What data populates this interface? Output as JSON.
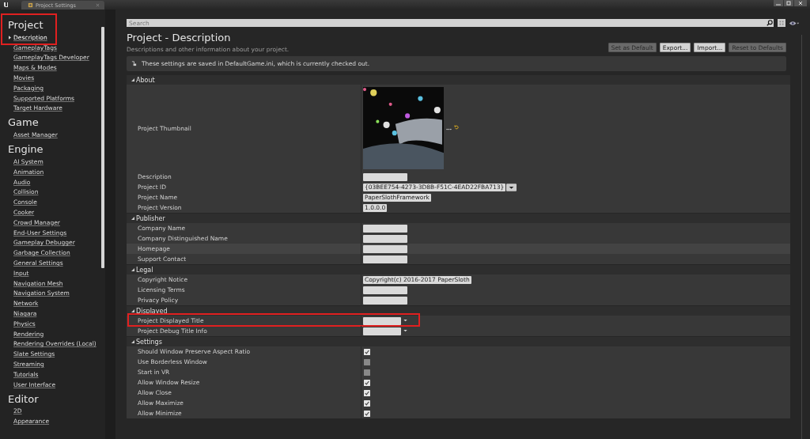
{
  "tab": {
    "title": "Project Settings"
  },
  "sidebar": {
    "sections": [
      {
        "heading": "Project",
        "highlighted": true,
        "items": [
          {
            "label": "Description",
            "selected": true
          },
          {
            "label": "GameplayTags",
            "selected": false
          },
          {
            "label": "GameplayTags Developer",
            "selected": false
          },
          {
            "label": "Maps & Modes",
            "selected": false
          },
          {
            "label": "Movies",
            "selected": false
          },
          {
            "label": "Packaging",
            "selected": false
          },
          {
            "label": "Supported Platforms",
            "selected": false
          },
          {
            "label": "Target Hardware",
            "selected": false
          }
        ]
      },
      {
        "heading": "Game",
        "items": [
          {
            "label": "Asset Manager",
            "selected": false
          }
        ]
      },
      {
        "heading": "Engine",
        "items": [
          {
            "label": "AI System",
            "selected": false
          },
          {
            "label": "Animation",
            "selected": false
          },
          {
            "label": "Audio",
            "selected": false
          },
          {
            "label": "Collision",
            "selected": false
          },
          {
            "label": "Console",
            "selected": false
          },
          {
            "label": "Cooker",
            "selected": false
          },
          {
            "label": "Crowd Manager",
            "selected": false
          },
          {
            "label": "End-User Settings",
            "selected": false
          },
          {
            "label": "Gameplay Debugger",
            "selected": false
          },
          {
            "label": "Garbage Collection",
            "selected": false
          },
          {
            "label": "General Settings",
            "selected": false
          },
          {
            "label": "Input",
            "selected": false
          },
          {
            "label": "Navigation Mesh",
            "selected": false
          },
          {
            "label": "Navigation System",
            "selected": false
          },
          {
            "label": "Network",
            "selected": false
          },
          {
            "label": "Niagara",
            "selected": false
          },
          {
            "label": "Physics",
            "selected": false
          },
          {
            "label": "Rendering",
            "selected": false
          },
          {
            "label": "Rendering Overrides (Local)",
            "selected": false
          },
          {
            "label": "Slate Settings",
            "selected": false
          },
          {
            "label": "Streaming",
            "selected": false
          },
          {
            "label": "Tutorials",
            "selected": false
          },
          {
            "label": "User Interface",
            "selected": false
          }
        ]
      },
      {
        "heading": "Editor",
        "items": [
          {
            "label": "2D",
            "selected": false
          },
          {
            "label": "Appearance",
            "selected": false
          }
        ]
      }
    ]
  },
  "search": {
    "placeholder": "Search"
  },
  "header": {
    "title": "Project - Description",
    "subtitle": "Descriptions and other information about your project."
  },
  "buttons": [
    {
      "label": "Set as Default",
      "disabled": true
    },
    {
      "label": "Export...",
      "disabled": false
    },
    {
      "label": "Import...",
      "disabled": false
    },
    {
      "label": "Reset to Defaults",
      "disabled": true
    }
  ],
  "notice": "These settings are saved in DefaultGame.ini, which is currently checked out.",
  "categories": [
    {
      "name": "About",
      "expanded": true,
      "rows": [
        {
          "label": "Project Thumbnail",
          "kind": "thumbnail"
        },
        {
          "label": "Description",
          "kind": "text"
        },
        {
          "label": "Project ID",
          "kind": "combo",
          "value": "{03BEE754-4273-3D8B-F51C-4EAD22FBA713}"
        },
        {
          "label": "Project Name",
          "kind": "text",
          "value": "PaperSlothFramework"
        },
        {
          "label": "Project Version",
          "kind": "text",
          "value": "1.0.0.0"
        }
      ]
    },
    {
      "name": "Publisher",
      "expanded": true,
      "rows": [
        {
          "label": "Company Name",
          "kind": "text"
        },
        {
          "label": "Company Distinguished Name",
          "kind": "text"
        },
        {
          "label": "Homepage",
          "kind": "text",
          "hovered": true
        },
        {
          "label": "Support Contact",
          "kind": "text"
        }
      ]
    },
    {
      "name": "Legal",
      "expanded": true,
      "rows": [
        {
          "label": "Copyright Notice",
          "kind": "text",
          "value": "Copyright(c) 2016-2017 PaperSloth"
        },
        {
          "label": "Licensing Terms",
          "kind": "text"
        },
        {
          "label": "Privacy Policy",
          "kind": "text"
        }
      ]
    },
    {
      "name": "Displayed",
      "expanded": true,
      "rows": [
        {
          "label": "Project Displayed Title",
          "kind": "dropdown",
          "highlighted": true
        },
        {
          "label": "Project Debug Title Info",
          "kind": "dropdown"
        }
      ]
    },
    {
      "name": "Settings",
      "expanded": true,
      "rows": [
        {
          "label": "Should Window Preserve Aspect Ratio",
          "kind": "checkbox",
          "checked": true
        },
        {
          "label": "Use Borderless Window",
          "kind": "checkbox",
          "checked": false
        },
        {
          "label": "Start in VR",
          "kind": "checkbox",
          "checked": false
        },
        {
          "label": "Allow Window Resize",
          "kind": "checkbox",
          "checked": true
        },
        {
          "label": "Allow Close",
          "kind": "checkbox",
          "checked": true
        },
        {
          "label": "Allow Maximize",
          "kind": "checkbox",
          "checked": true
        },
        {
          "label": "Allow Minimize",
          "kind": "checkbox",
          "checked": true
        }
      ]
    }
  ]
}
